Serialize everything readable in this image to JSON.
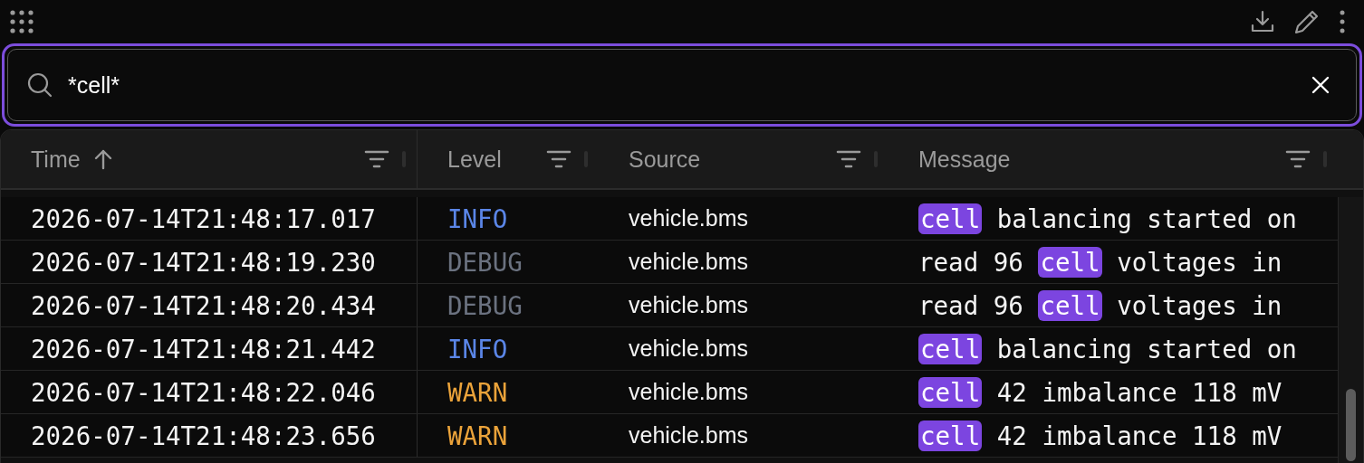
{
  "search": {
    "value": "*cell*"
  },
  "table": {
    "columns": [
      {
        "label": "Time",
        "sorted": true
      },
      {
        "label": "Level",
        "sorted": false
      },
      {
        "label": "Source",
        "sorted": false
      },
      {
        "label": "Message",
        "sorted": false
      }
    ],
    "rows": [
      {
        "time": "2026-07-14T21:48:17.017",
        "level": "INFO",
        "color": "#5b86e8",
        "source": "vehicle.bms",
        "message": [
          {
            "text": "cell",
            "match": true
          },
          {
            "text": " balancing started on",
            "match": false
          }
        ]
      },
      {
        "time": "2026-07-14T21:48:19.230",
        "level": "DEBUG",
        "color": "#6b7280",
        "source": "vehicle.bms",
        "message": [
          {
            "text": "read 96 ",
            "match": false
          },
          {
            "text": "cell",
            "match": true
          },
          {
            "text": " voltages in",
            "match": false
          }
        ]
      },
      {
        "time": "2026-07-14T21:48:20.434",
        "level": "DEBUG",
        "color": "#6b7280",
        "source": "vehicle.bms",
        "message": [
          {
            "text": "read 96 ",
            "match": false
          },
          {
            "text": "cell",
            "match": true
          },
          {
            "text": " voltages in",
            "match": false
          }
        ]
      },
      {
        "time": "2026-07-14T21:48:21.442",
        "level": "INFO",
        "color": "#5b86e8",
        "source": "vehicle.bms",
        "message": [
          {
            "text": "cell",
            "match": true
          },
          {
            "text": " balancing started on",
            "match": false
          }
        ]
      },
      {
        "time": "2026-07-14T21:48:22.046",
        "level": "WARN",
        "color": "#eba33a",
        "source": "vehicle.bms",
        "message": [
          {
            "text": "cell",
            "match": true
          },
          {
            "text": " 42 imbalance 118 mV",
            "match": false
          }
        ]
      },
      {
        "time": "2026-07-14T21:48:23.656",
        "level": "WARN",
        "color": "#eba33a",
        "source": "vehicle.bms",
        "message": [
          {
            "text": "cell",
            "match": true
          },
          {
            "text": " 42 imbalance 118 mV",
            "match": false
          }
        ]
      }
    ]
  }
}
